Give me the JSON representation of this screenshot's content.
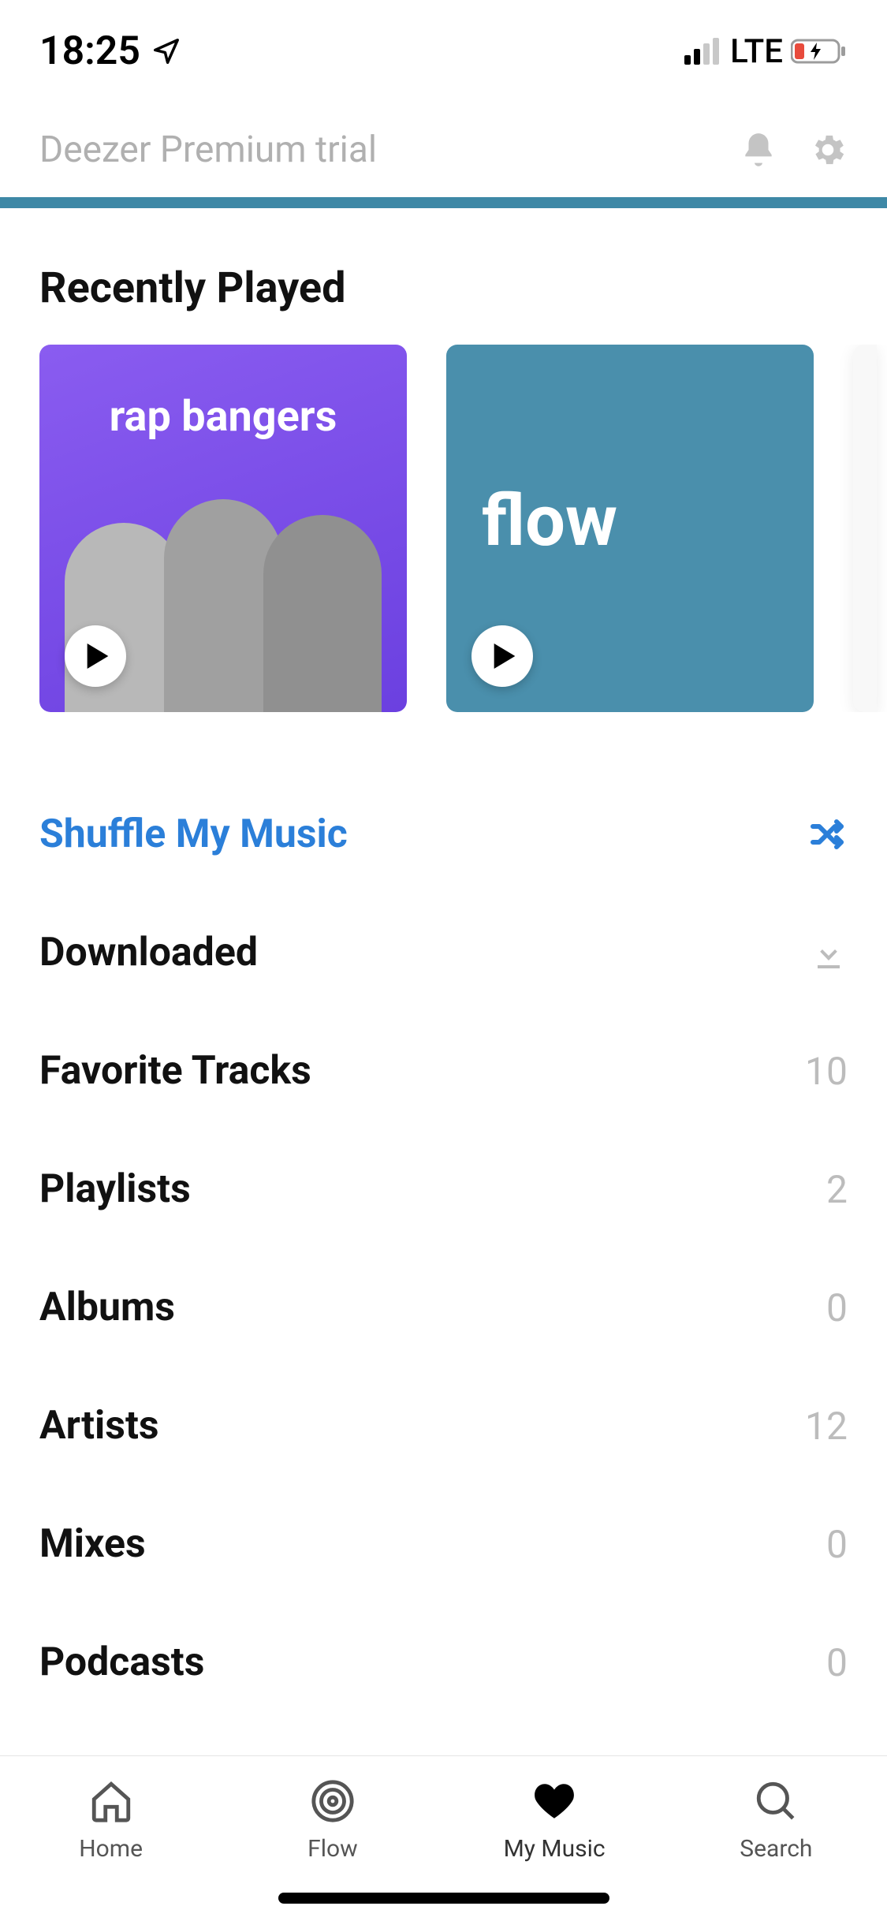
{
  "status": {
    "time": "18:25",
    "network": "LTE"
  },
  "header": {
    "title": "Deezer Premium trial"
  },
  "sections": {
    "recent_title": "Recently Played"
  },
  "cards": {
    "rap": {
      "title": "rap bangers"
    },
    "flow": {
      "title": "flow"
    }
  },
  "list": {
    "shuffle": {
      "label": "Shuffle My Music"
    },
    "items": [
      {
        "label": "Downloaded",
        "count": ""
      },
      {
        "label": "Favorite Tracks",
        "count": "10"
      },
      {
        "label": "Playlists",
        "count": "2"
      },
      {
        "label": "Albums",
        "count": "0"
      },
      {
        "label": "Artists",
        "count": "12"
      },
      {
        "label": "Mixes",
        "count": "0"
      },
      {
        "label": "Podcasts",
        "count": "0"
      }
    ]
  },
  "tabs": {
    "home": "Home",
    "flow": "Flow",
    "mymusic": "My Music",
    "search": "Search"
  }
}
